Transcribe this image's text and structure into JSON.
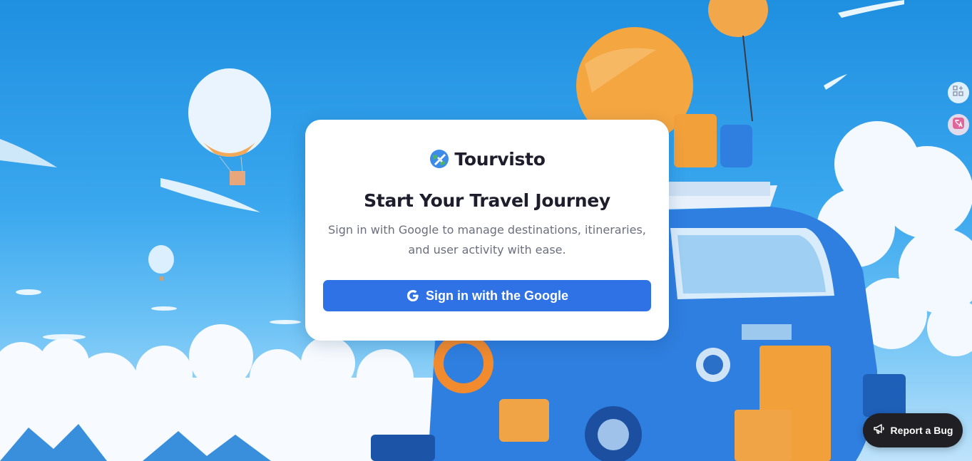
{
  "app": {
    "brand_name": "Tourvisto",
    "brand_icon": "globe-plane-icon"
  },
  "login": {
    "title": "Start Your Travel Journey",
    "subtitle_line1": "Sign in with Google to manage destinations, itineraries,",
    "subtitle_line2": "and user activity with ease.",
    "google_button_label": "Sign in with the Google",
    "google_button_icon": "google-g-icon"
  },
  "side_tools": [
    {
      "icon": "apps-add-icon"
    },
    {
      "icon": "translate-icon"
    }
  ],
  "report_bug": {
    "label": "Report a Bug",
    "icon": "megaphone-icon"
  },
  "colors": {
    "primary_button": "#2f72e5",
    "card_bg": "#ffffff",
    "title_text": "#1d1d2c",
    "subtitle_text": "#6b6f7d",
    "bug_button_bg": "#1f1f24"
  }
}
